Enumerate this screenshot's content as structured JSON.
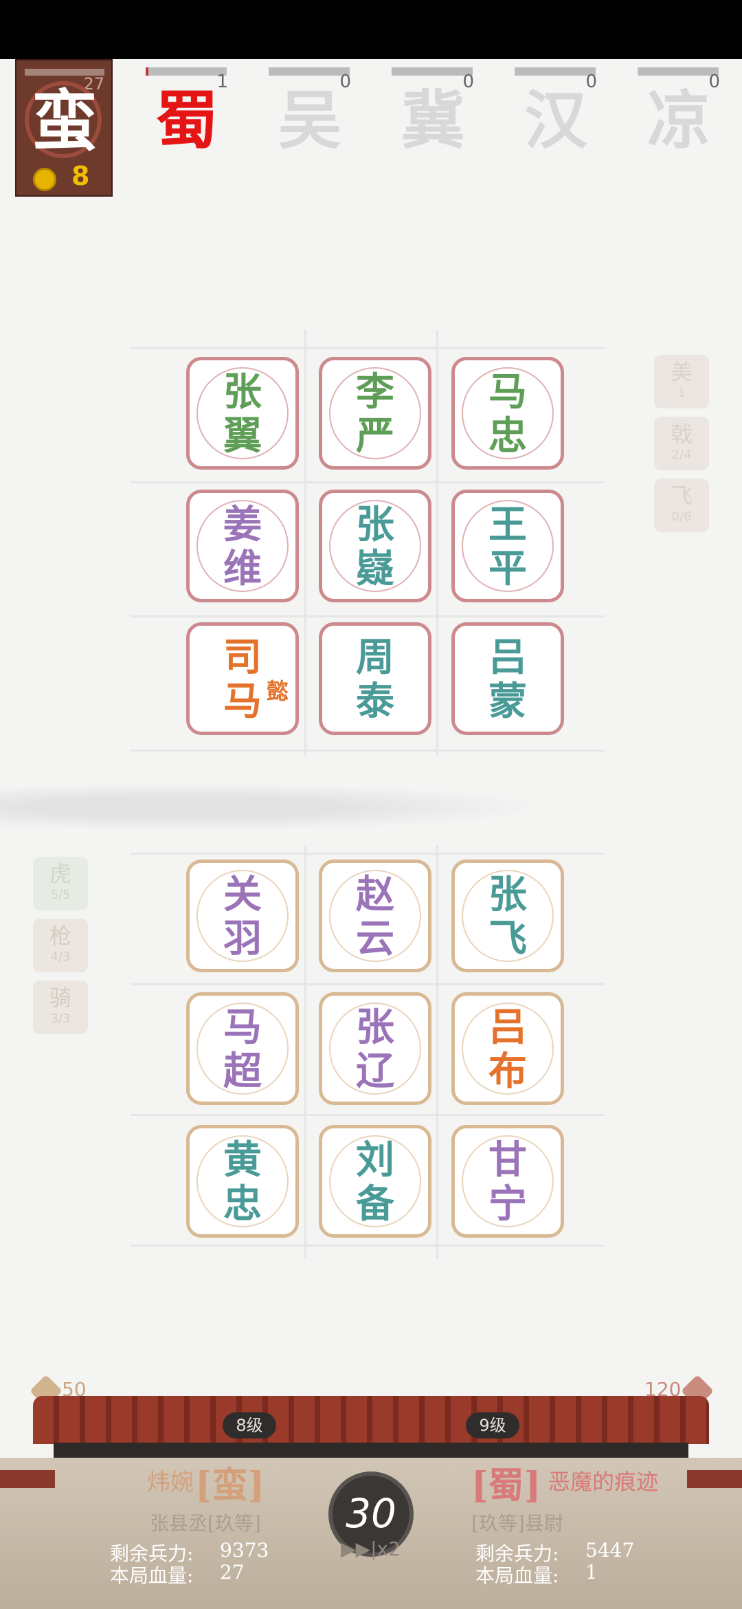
{
  "player": {
    "char": "蛮",
    "hp": "27",
    "coins": "8"
  },
  "factions": [
    {
      "name": "蜀",
      "count": "1"
    },
    {
      "name": "吴",
      "count": "0"
    },
    {
      "name": "冀",
      "count": "0"
    },
    {
      "name": "汉",
      "count": "0"
    },
    {
      "name": "凉",
      "count": "0"
    }
  ],
  "enemy_board": [
    {
      "line1": "张",
      "line2": "翼",
      "color": "green"
    },
    {
      "line1": "李",
      "line2": "严",
      "color": "green"
    },
    {
      "line1": "马",
      "line2": "忠",
      "color": "green"
    },
    {
      "line1": "姜",
      "line2": "维",
      "color": "purple"
    },
    {
      "line1": "张",
      "line2": "嶷",
      "color": "teal"
    },
    {
      "line1": "王",
      "line2": "平",
      "color": "teal"
    },
    {
      "line1": "司",
      "line2": "马",
      "sub": "懿",
      "color": "orange"
    },
    {
      "line1": "周",
      "line2": "泰",
      "color": "teal"
    },
    {
      "line1": "吕",
      "line2": "蒙",
      "color": "teal"
    }
  ],
  "player_board": [
    {
      "line1": "关",
      "line2": "羽",
      "color": "purple"
    },
    {
      "line1": "赵",
      "line2": "云",
      "color": "purple"
    },
    {
      "line1": "张",
      "line2": "飞",
      "color": "teal"
    },
    {
      "line1": "马",
      "line2": "超",
      "color": "purple"
    },
    {
      "line1": "张",
      "line2": "辽",
      "color": "purple"
    },
    {
      "line1": "吕",
      "line2": "布",
      "color": "orange"
    },
    {
      "line1": "黄",
      "line2": "忠",
      "color": "teal"
    },
    {
      "line1": "刘",
      "line2": "备",
      "color": "teal"
    },
    {
      "line1": "甘",
      "line2": "宁",
      "color": "purple"
    }
  ],
  "enemy_buffs": [
    {
      "name": "美",
      "val": "1"
    },
    {
      "name": "戟",
      "val": "2/4"
    },
    {
      "name": "飞",
      "val": "0/6"
    }
  ],
  "player_buffs": [
    {
      "name": "虎",
      "val": "5/5"
    },
    {
      "name": "枪",
      "val": "4/3"
    },
    {
      "name": "骑",
      "val": "3/3"
    }
  ],
  "bottom": {
    "left_coin": "50",
    "right_coin": "120",
    "left_level": "8级",
    "right_level": "9级",
    "left_name": "炜婉",
    "left_faction": "[蛮]",
    "left_title": "张县丞[玖等]",
    "right_faction": "[蜀]",
    "right_name": "恶魔的痕迹",
    "right_title": "[玖等]县尉",
    "left_troops_label": "剩余兵力:",
    "left_troops": "9373",
    "left_hp_label": "本局血量:",
    "left_hp": "27",
    "right_troops_label": "剩余兵力:",
    "right_troops": "5447",
    "right_hp_label": "本局血量:",
    "right_hp": "1",
    "timer": "30",
    "speed": "▶▶|x2"
  }
}
